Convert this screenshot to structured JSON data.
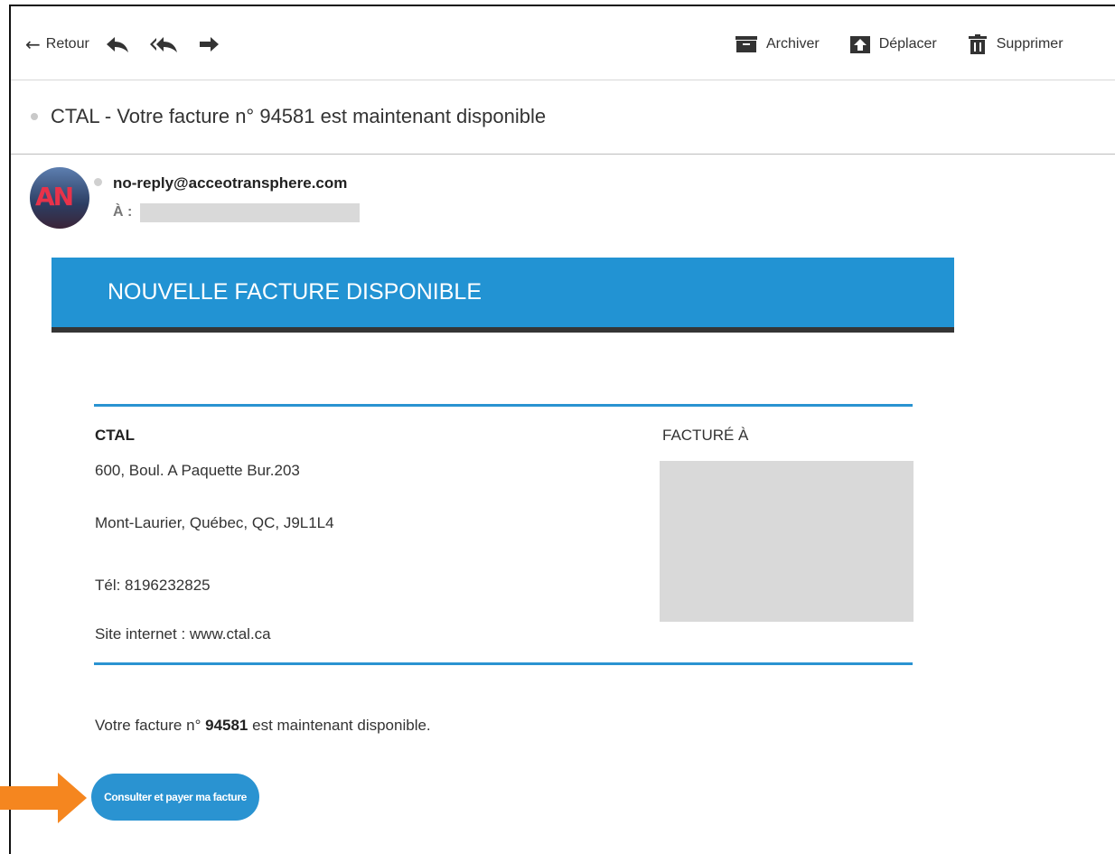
{
  "toolbar": {
    "back_label": "Retour",
    "archive_label": "Archiver",
    "move_label": "Déplacer",
    "delete_label": "Supprimer"
  },
  "email": {
    "subject": "CTAL - Votre facture n° 94581 est maintenant disponible",
    "sender": "no-reply@acceotransphere.com",
    "to_label": "À :"
  },
  "content": {
    "banner_title": "NOUVELLE FACTURE DISPONIBLE",
    "company_name": "CTAL",
    "address_line1": "600, Boul. A Paquette Bur.203",
    "address_line2": "Mont-Laurier, Québec, QC, J9L1L4",
    "phone": "Tél: 8196232825",
    "website": "Site internet : www.ctal.ca",
    "billed_to_label": "FACTURÉ À",
    "message_prefix": "Votre facture n°",
    "invoice_number": "94581",
    "message_suffix": "est maintenant disponible.",
    "cta_label": "Consulter et payer ma facture"
  },
  "colors": {
    "banner": "#2293d3",
    "banner_border": "#353535",
    "accent": "#2a93d1",
    "annotation_arrow": "#f5861f"
  }
}
